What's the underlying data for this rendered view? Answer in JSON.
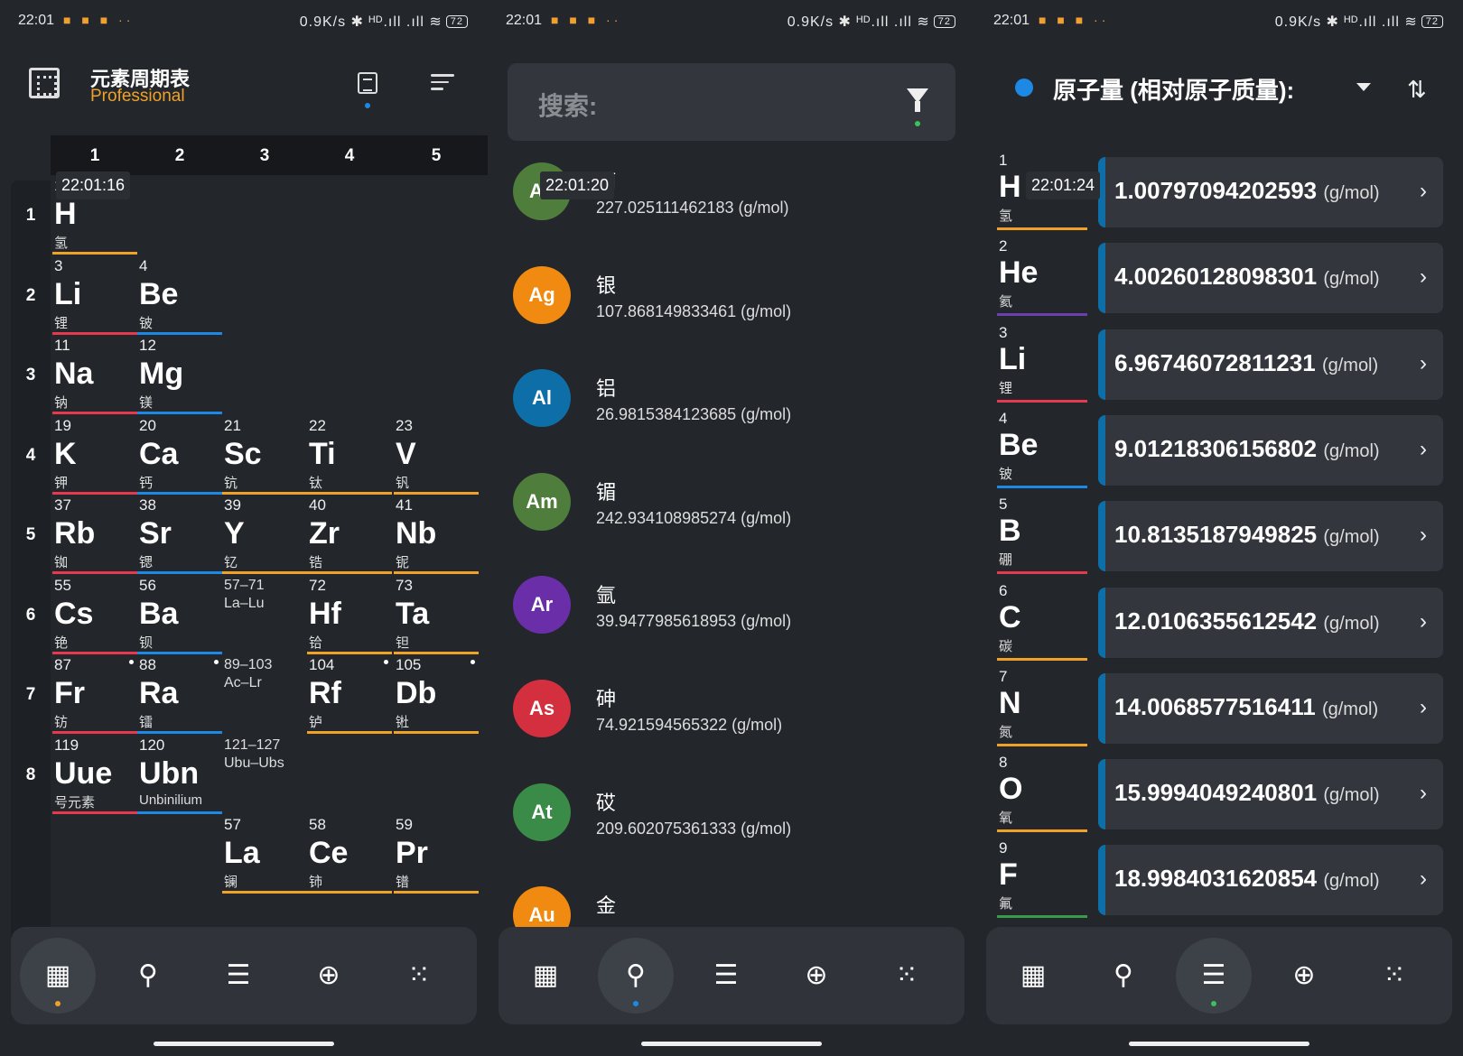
{
  "status": {
    "time": "22:01",
    "right": "0.9K/s ✱ ᴴᴰ.ıll .ıll ≋",
    "battery": "72"
  },
  "colors": {
    "orange": "#f0a228",
    "blue": "#1e88e5",
    "red": "#e53950",
    "nav_dot_orange": "#f0a228",
    "nav_dot_blue": "#1e88e5",
    "nav_dot_green": "#3bbf5f"
  },
  "panel1": {
    "title": "元素周期表",
    "subtitle": "Professional",
    "overlay_time": "22:01:16",
    "columns": [
      "1",
      "2",
      "3",
      "4",
      "5"
    ],
    "rows": [
      "1",
      "2",
      "3",
      "4",
      "5",
      "6",
      "7",
      "8"
    ],
    "elements": [
      {
        "num": "1",
        "sym": "H",
        "name": "氢"
      },
      {
        "num": "3",
        "sym": "Li",
        "name": "锂"
      },
      {
        "num": "4",
        "sym": "Be",
        "name": "铍"
      },
      {
        "num": "11",
        "sym": "Na",
        "name": "钠"
      },
      {
        "num": "12",
        "sym": "Mg",
        "name": "镁"
      },
      {
        "num": "19",
        "sym": "K",
        "name": "钾"
      },
      {
        "num": "20",
        "sym": "Ca",
        "name": "钙"
      },
      {
        "num": "21",
        "sym": "Sc",
        "name": "钪"
      },
      {
        "num": "22",
        "sym": "Ti",
        "name": "钛"
      },
      {
        "num": "23",
        "sym": "V",
        "name": "钒"
      },
      {
        "num": "37",
        "sym": "Rb",
        "name": "铷"
      },
      {
        "num": "38",
        "sym": "Sr",
        "name": "锶"
      },
      {
        "num": "39",
        "sym": "Y",
        "name": "钇"
      },
      {
        "num": "40",
        "sym": "Zr",
        "name": "锆"
      },
      {
        "num": "41",
        "sym": "Nb",
        "name": "铌"
      },
      {
        "num": "55",
        "sym": "Cs",
        "name": "铯"
      },
      {
        "num": "56",
        "sym": "Ba",
        "name": "钡"
      },
      {
        "num": "72",
        "sym": "Hf",
        "name": "铪"
      },
      {
        "num": "73",
        "sym": "Ta",
        "name": "钽"
      },
      {
        "num": "87",
        "sym": "Fr",
        "name": "钫"
      },
      {
        "num": "88",
        "sym": "Ra",
        "name": "镭"
      },
      {
        "num": "104",
        "sym": "Rf",
        "name": "𬬻"
      },
      {
        "num": "105",
        "sym": "Db",
        "name": "𬭊"
      },
      {
        "num": "119",
        "sym": "Uue",
        "name": "号元素"
      },
      {
        "num": "120",
        "sym": "Ubn",
        "name": "Unbinilium"
      },
      {
        "num": "57",
        "sym": "La",
        "name": "镧"
      },
      {
        "num": "58",
        "sym": "Ce",
        "name": "铈"
      },
      {
        "num": "59",
        "sym": "Pr",
        "name": "镨"
      }
    ],
    "placeholders": [
      {
        "range": "57–71",
        "label": "La–Lu"
      },
      {
        "range": "89–103",
        "label": "Ac–Lr"
      },
      {
        "range": "121–127",
        "label": "Ubu–Ubs"
      }
    ]
  },
  "panel2": {
    "search_placeholder": "搜索:",
    "overlay_time": "22:01:20",
    "items": [
      {
        "sym": "Ac",
        "name": "锕",
        "mass": "227.025111462183 (g/mol)",
        "color": "#4e7d3c"
      },
      {
        "sym": "Ag",
        "name": "银",
        "mass": "107.868149833461 (g/mol)",
        "color": "#f08a10"
      },
      {
        "sym": "Al",
        "name": "铝",
        "mass": "26.9815384123685 (g/mol)",
        "color": "#0d6ea8"
      },
      {
        "sym": "Am",
        "name": "镅",
        "mass": "242.934108985274 (g/mol)",
        "color": "#4e7d3c"
      },
      {
        "sym": "Ar",
        "name": "氩",
        "mass": "39.9477985618953 (g/mol)",
        "color": "#6a2fa8"
      },
      {
        "sym": "As",
        "name": "砷",
        "mass": "74.921594565322 (g/mol)",
        "color": "#d32f3f"
      },
      {
        "sym": "At",
        "name": "砹",
        "mass": "209.602075361333 (g/mol)",
        "color": "#3a8a48"
      },
      {
        "sym": "Au",
        "name": "金",
        "mass": "",
        "color": "#f08a10"
      }
    ]
  },
  "panel3": {
    "title": "原子量 (相对原子质量):",
    "overlay_time": "22:01:24",
    "unit": "(g/mol)",
    "rows": [
      {
        "num": "1",
        "sym": "H",
        "name": "氢",
        "value": "1.00797094202593",
        "bar": "#f0a228"
      },
      {
        "num": "2",
        "sym": "He",
        "name": "氦",
        "value": "4.00260128098301",
        "bar": "#6a3fb0"
      },
      {
        "num": "3",
        "sym": "Li",
        "name": "锂",
        "value": "6.96746072811231",
        "bar": "#e53950"
      },
      {
        "num": "4",
        "sym": "Be",
        "name": "铍",
        "value": "9.01218306156802",
        "bar": "#1e88e5"
      },
      {
        "num": "5",
        "sym": "B",
        "name": "硼",
        "value": "10.8135187949825",
        "bar": "#e53950"
      },
      {
        "num": "6",
        "sym": "C",
        "name": "碳",
        "value": "12.0106355612542",
        "bar": "#f0a228"
      },
      {
        "num": "7",
        "sym": "N",
        "name": "氮",
        "value": "14.0068577516411",
        "bar": "#f0a228"
      },
      {
        "num": "8",
        "sym": "O",
        "name": "氧",
        "value": "15.9994049240801",
        "bar": "#f0a228"
      },
      {
        "num": "9",
        "sym": "F",
        "name": "氟",
        "value": "18.9984031620854",
        "bar": "#3a9a4a"
      }
    ]
  },
  "nav": {
    "items": [
      {
        "icon": "periodic-table-icon",
        "glyph": "▦"
      },
      {
        "icon": "search-icon",
        "glyph": "⚲"
      },
      {
        "icon": "list-icon",
        "glyph": "☰"
      },
      {
        "icon": "add-circle-icon",
        "glyph": "⊕"
      },
      {
        "icon": "molecule-icon",
        "glyph": "⁙"
      }
    ]
  }
}
